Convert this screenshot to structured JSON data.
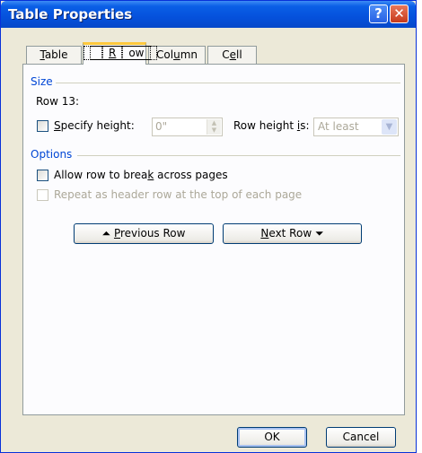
{
  "window": {
    "title": "Table Properties",
    "help_glyph": "?",
    "close_glyph": "✕"
  },
  "tabs": [
    {
      "pre": "",
      "u": "T",
      "post": "able"
    },
    {
      "pre": "",
      "u": "R",
      "post": "ow"
    },
    {
      "pre": "Col",
      "u": "u",
      "post": "mn"
    },
    {
      "pre": "C",
      "u": "e",
      "post": "ll"
    }
  ],
  "size_group": {
    "label": "Size",
    "row_label": "Row 13:",
    "specify_height": {
      "pre": "",
      "u": "S",
      "post": "pecify height:",
      "checked": false
    },
    "height_value": "0\"",
    "row_height_is": {
      "pre": "Row height ",
      "u": "i",
      "post": "s:"
    },
    "row_height_mode": "At least"
  },
  "options_group": {
    "label": "Options",
    "allow_break": {
      "pre": "Allow row to brea",
      "u": "k",
      "post": " across pages",
      "checked": false
    },
    "repeat_header": {
      "text": "Repeat as header row at the top of each page",
      "checked": false,
      "disabled": true
    }
  },
  "nav": {
    "prev": {
      "glyph": "⏶",
      "pre": "",
      "u": "P",
      "post": "revious Row"
    },
    "next": {
      "pre": "",
      "u": "N",
      "post": "ext Row",
      "glyph": "⏷"
    }
  },
  "footer": {
    "ok": "OK",
    "cancel": "Cancel"
  }
}
